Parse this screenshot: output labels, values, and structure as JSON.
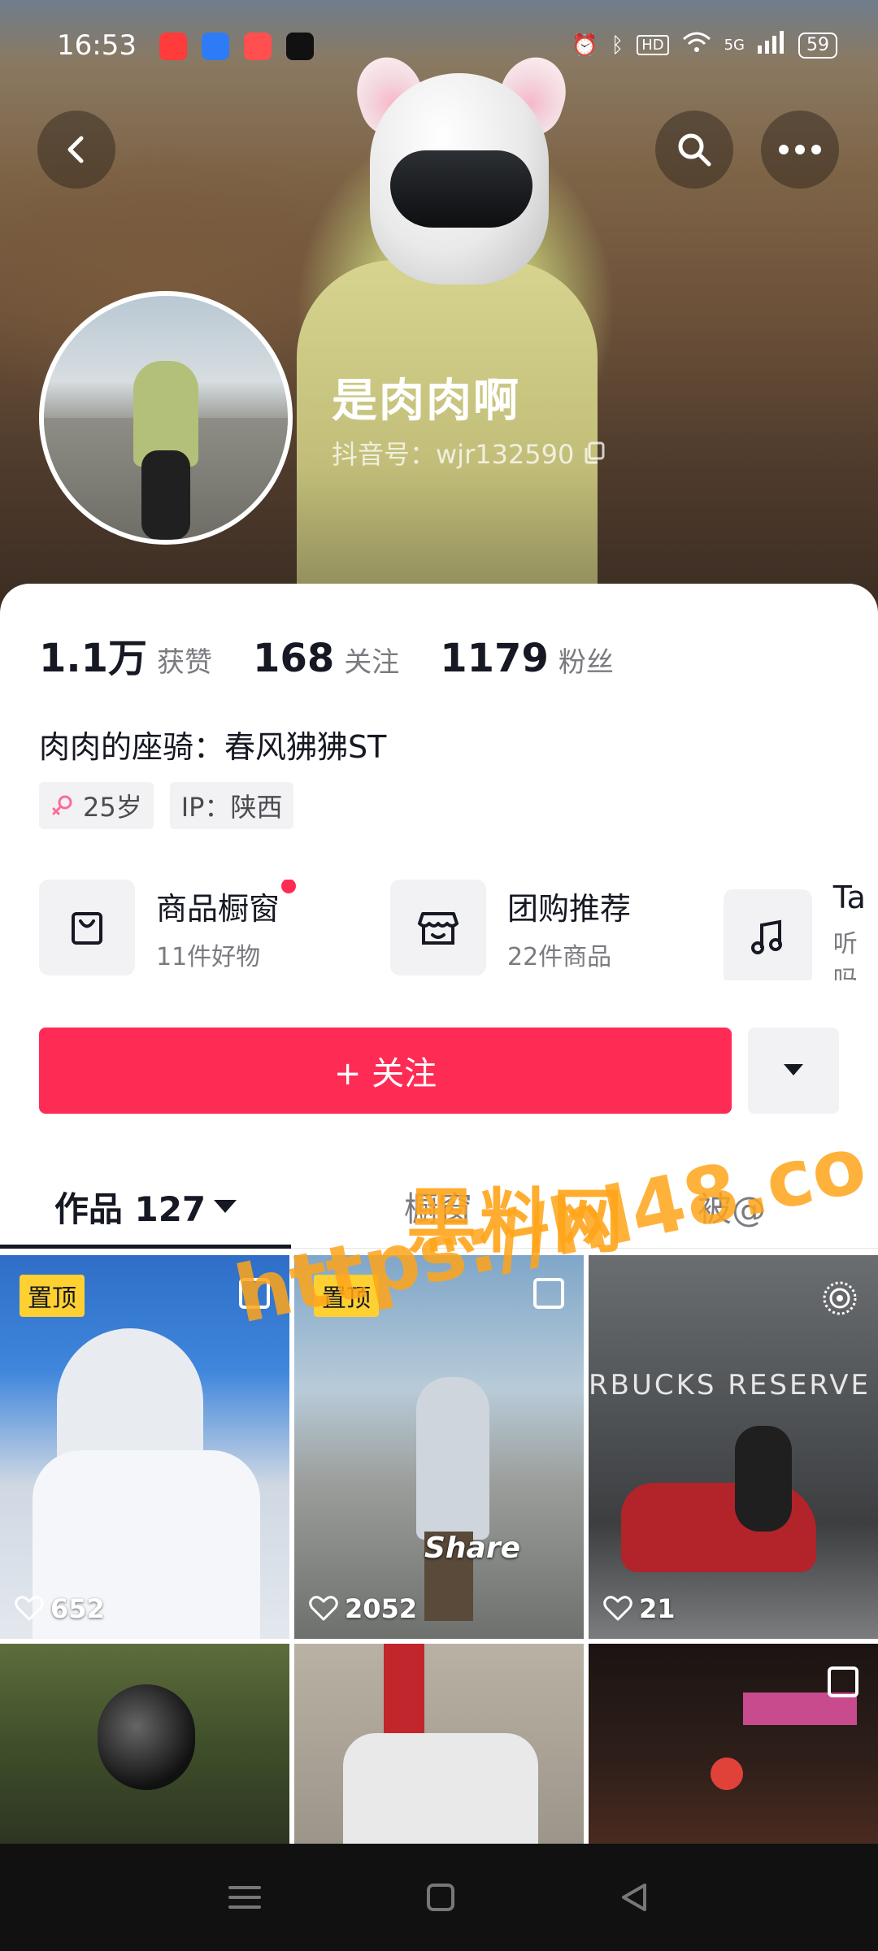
{
  "status_bar": {
    "time": "16:53",
    "battery": "59",
    "signal": "5G",
    "hd": "HD"
  },
  "profile": {
    "nickname": "是肉肉啊",
    "douyin_id": "抖音号：wjr132590",
    "bio": "肉肉的座骑：春风狒狒ST",
    "tags": {
      "age": "25岁",
      "ip": "IP：陕西"
    }
  },
  "stats": {
    "likes_num": "1.1万",
    "likes_label": "获赞",
    "following_num": "168",
    "following_label": "关注",
    "followers_num": "1179",
    "followers_label": "粉丝"
  },
  "services": [
    {
      "title": "商品橱窗",
      "sub": "11件好物",
      "icon": "shopping-bag-icon"
    },
    {
      "title": "团购推荐",
      "sub": "22件商品",
      "icon": "store-icon"
    },
    {
      "title": "Ta",
      "sub": "听吗",
      "icon": "music-note-icon"
    }
  ],
  "actions": {
    "follow_label": "+ 关注"
  },
  "tabs": {
    "works": "作品 127",
    "showcase": "橱窗",
    "mentions": "被@"
  },
  "grid": [
    {
      "pinned": "置顶",
      "likes": "652"
    },
    {
      "pinned": "置顶",
      "likes": "2052",
      "overlay_text": "Share"
    },
    {
      "likes": "21",
      "overlay_text": "RBUCKS RESERVE"
    },
    {},
    {},
    {}
  ],
  "watermark": {
    "line1": "黑料网",
    "line2": "https://hl48.co"
  },
  "colors": {
    "accent": "#fe2c55",
    "pin": "#fed032",
    "watermark": "#ffa51a"
  }
}
